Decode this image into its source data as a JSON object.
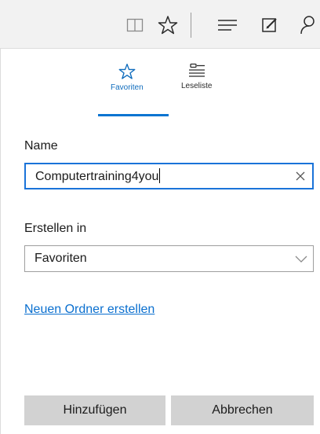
{
  "toolbar": {
    "icons": [
      "reading-view-icon",
      "favorites-star-icon",
      "hub-icon",
      "web-note-icon",
      "share-icon"
    ]
  },
  "tabs": [
    {
      "label": "Favoriten",
      "icon": "star-icon",
      "active": true
    },
    {
      "label": "Leseliste",
      "icon": "reading-list-icon",
      "active": false
    }
  ],
  "form": {
    "name_label": "Name",
    "name_value": "Computertraining4you",
    "location_label": "Erstellen in",
    "location_value": "Favoriten",
    "new_folder_link": "Neuen Ordner erstellen"
  },
  "buttons": {
    "add_label": "Hinzufügen",
    "cancel_label": "Abbrechen"
  },
  "colors": {
    "accent": "#0a74d1",
    "link": "#0a6fcf",
    "button_bg": "#d2d2d2",
    "toolbar_bg": "#f2f2f2"
  }
}
